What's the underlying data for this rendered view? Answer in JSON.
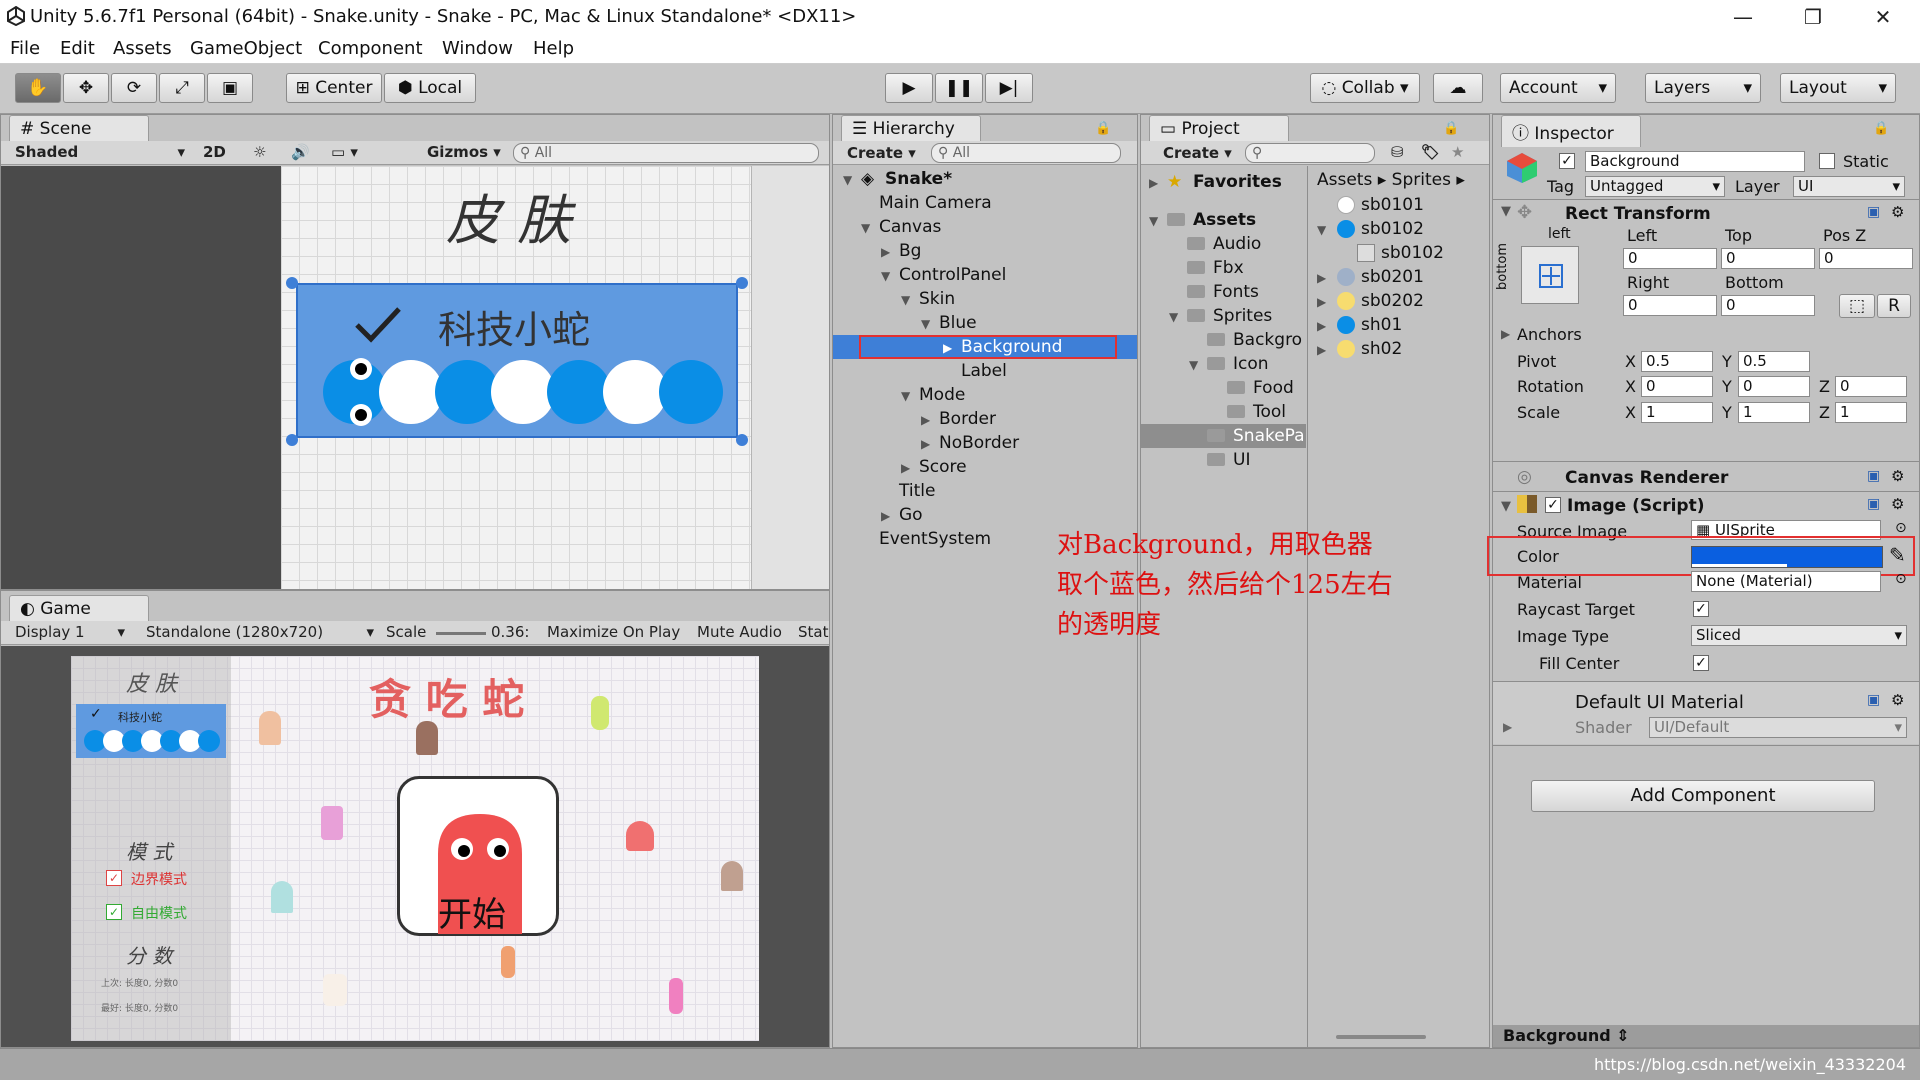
{
  "window": {
    "title": "Unity 5.6.7f1 Personal (64bit) - Snake.unity - Snake - PC, Mac & Linux Standalone* <DX11>"
  },
  "menu": [
    "File",
    "Edit",
    "Assets",
    "GameObject",
    "Component",
    "Window",
    "Help"
  ],
  "toolbar": {
    "center": "Center",
    "local": "Local",
    "collab": "Collab",
    "account": "Account",
    "layers": "Layers",
    "layout": "Layout"
  },
  "scene": {
    "tab": "Scene",
    "shaded": "Shaded",
    "mode2d": "2D",
    "gizmos": "Gizmos",
    "search": "All",
    "title": "皮 肤",
    "label": "科技小蛇"
  },
  "game": {
    "tab": "Game",
    "display": "Display 1",
    "resolution": "Standalone (1280x720)",
    "scale_label": "Scale",
    "scale_value": "0.36:",
    "maximize": "Maximize On Play",
    "mute": "Mute Audio",
    "stats": "Stat",
    "skin_title": "皮 肤",
    "skin_item": "科技小蛇",
    "game_title": "贪 吃 蛇",
    "mode_title": "模 式",
    "mode1": "边界模式",
    "mode2": "自由模式",
    "score_title": "分 数",
    "score_row1": "上次: 长度0, 分数0",
    "score_row2": "最好: 长度0, 分数0",
    "start": "开始"
  },
  "hierarchy": {
    "tab": "Hierarchy",
    "create": "Create",
    "search": "All",
    "items": [
      "Snake*",
      "Main Camera",
      "Canvas",
      "Bg",
      "ControlPanel",
      "Skin",
      "Blue",
      "Background",
      "Label",
      "Mode",
      "Border",
      "NoBorder",
      "Score",
      "Title",
      "Go",
      "EventSystem"
    ]
  },
  "project": {
    "tab": "Project",
    "create": "Create",
    "favorites": "Favorites",
    "assets": "Assets",
    "breadcrumb1": "Assets",
    "breadcrumb2": "Sprites",
    "folders": [
      "Assets",
      "Audio",
      "Fbx",
      "Fonts",
      "Sprites",
      "Backgro",
      "Icon",
      "Food",
      "Tool",
      "SnakePa",
      "UI"
    ],
    "sprites": [
      "sb0101",
      "sb0102",
      "sb0102",
      "sb0201",
      "sb0202",
      "sh01",
      "sh02"
    ]
  },
  "inspector": {
    "tab": "Inspector",
    "name": "Background",
    "static": "Static",
    "tag_label": "Tag",
    "tag": "Untagged",
    "layer_label": "Layer",
    "layer": "UI",
    "rect_transform": "Rect Transform",
    "anchor_left": "left",
    "anchor_bottom": "bottom",
    "left_label": "Left",
    "top_label": "Top",
    "posz_label": "Pos Z",
    "left": "0",
    "top": "0",
    "posz": "0",
    "right_label": "Right",
    "bottom_label": "Bottom",
    "right": "0",
    "bottom": "0",
    "r_btn": "R",
    "anchors": "Anchors",
    "pivot": "Pivot",
    "pivot_x": "0.5",
    "pivot_y": "0.5",
    "rotation": "Rotation",
    "rot_x": "0",
    "rot_y": "0",
    "rot_z": "0",
    "scale": "Scale",
    "scale_x": "1",
    "scale_y": "1",
    "scale_z": "1",
    "canvas_renderer": "Canvas Renderer",
    "image_script": "Image (Script)",
    "source_image_label": "Source Image",
    "source_image": "UISprite",
    "color_label": "Color",
    "material_label": "Material",
    "material": "None (Material)",
    "raycast_label": "Raycast Target",
    "image_type_label": "Image Type",
    "image_type": "Sliced",
    "fill_center_label": "Fill Center",
    "default_material": "Default UI Material",
    "shader_label": "Shader",
    "shader": "UI/Default",
    "add_component": "Add Component",
    "preview": "Background",
    "x": "X",
    "y": "Y",
    "z": "Z"
  },
  "annotation": {
    "line1": "对Background，用取色器",
    "line2": "取个蓝色，然后给个125左右",
    "line3": "的透明度"
  },
  "watermark": "https://blog.csdn.net/weixin_43332204",
  "colors": {
    "selection": "#3e7fd7",
    "image_color": "#0a5fe0",
    "annotation": "#dd1111",
    "skin_panel": "#5f9ae0"
  }
}
